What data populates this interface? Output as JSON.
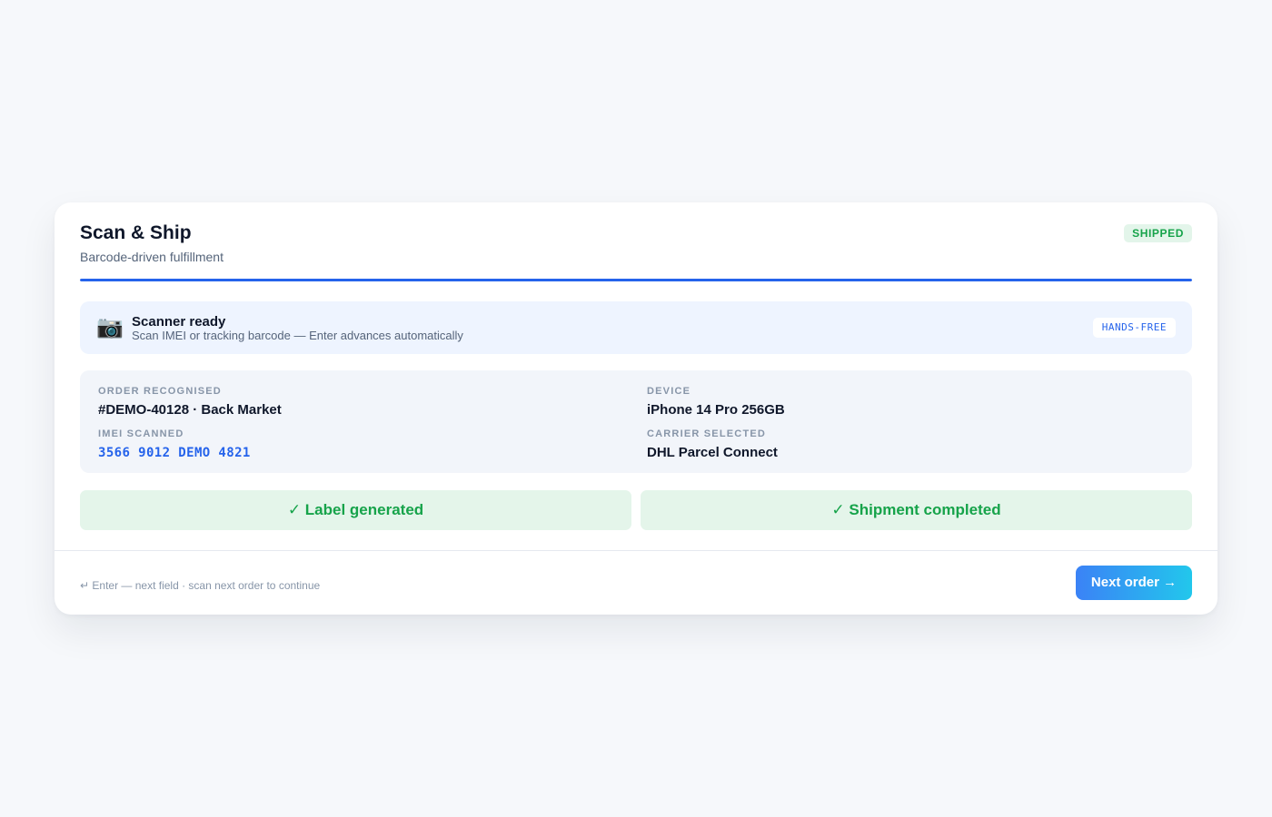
{
  "header": {
    "title": "Scan & Ship",
    "subtitle": "Barcode-driven fulfillment",
    "status_badge": "SHIPPED"
  },
  "progress": {
    "percent": 100,
    "color": "#2563eb"
  },
  "scanner": {
    "icon": "camera-icon",
    "icon_glyph": "📷",
    "title": "Scanner ready",
    "subtitle": "Scan IMEI or tracking barcode — Enter advances automatically",
    "mode_badge": "HANDS-FREE"
  },
  "details": {
    "order": {
      "label": "ORDER RECOGNISED",
      "value": "#DEMO-40128 · Back Market"
    },
    "device": {
      "label": "DEVICE",
      "value": "iPhone 14 Pro 256GB"
    },
    "imei": {
      "label": "IMEI SCANNED",
      "value": "3566 9012 DEMO 4821"
    },
    "carrier": {
      "label": "CARRIER SELECTED",
      "value": "DHL Parcel Connect"
    }
  },
  "steps": [
    {
      "label": "✓ Label generated",
      "status": "done"
    },
    {
      "label": "✓ Shipment completed",
      "status": "done"
    }
  ],
  "footer": {
    "hint": "↵ Enter — next field · scan next order to continue",
    "next_button": "Next order →"
  },
  "colors": {
    "accent": "#2563eb",
    "success": "#16a34a",
    "success_bg": "#e4f5ea",
    "button_gradient_start": "#3b82f6",
    "button_gradient_end": "#22c7ec"
  }
}
